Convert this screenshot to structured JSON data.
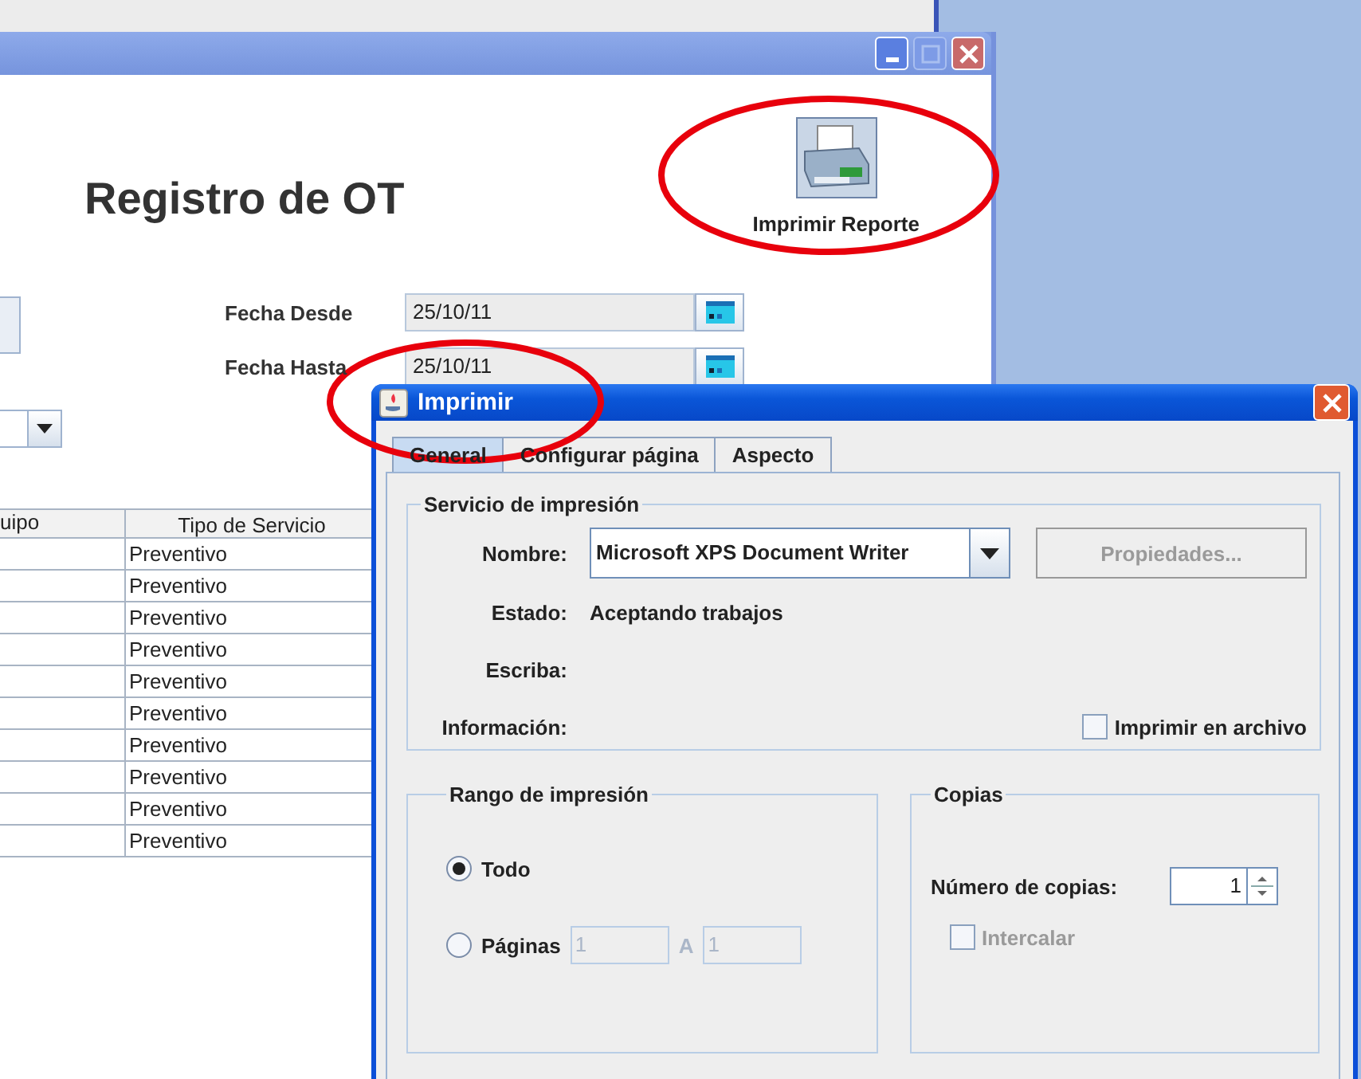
{
  "main_window": {
    "heading": "Registro de OT",
    "print_report_button": {
      "label": "Imprimir Reporte"
    },
    "date_fields": [
      {
        "label": "Fecha Desde",
        "value": "25/10/11"
      },
      {
        "label": "Fecha Hasta",
        "value": "25/10/11"
      }
    ],
    "table": {
      "columns": [
        "uipo",
        "Tipo de Servicio"
      ],
      "rows": [
        {
          "tipo_de_servicio": "Preventivo"
        },
        {
          "tipo_de_servicio": "Preventivo"
        },
        {
          "tipo_de_servicio": "Preventivo"
        },
        {
          "tipo_de_servicio": "Preventivo"
        },
        {
          "tipo_de_servicio": "Preventivo"
        },
        {
          "tipo_de_servicio": "Preventivo"
        },
        {
          "tipo_de_servicio": "Preventivo"
        },
        {
          "tipo_de_servicio": "Preventivo"
        },
        {
          "tipo_de_servicio": "Preventivo"
        },
        {
          "tipo_de_servicio": "Preventivo"
        }
      ]
    }
  },
  "annotations": [
    {
      "kind": "ellipse"
    },
    {
      "kind": "ellipse"
    }
  ],
  "dialog": {
    "title": "Imprimir",
    "tabs": [
      {
        "label": "General",
        "selected": true
      },
      {
        "label": "Configurar página",
        "selected": false
      },
      {
        "label": "Aspecto",
        "selected": false
      }
    ],
    "print_service": {
      "title": "Servicio de impresión",
      "name_label": "Nombre:",
      "printer": "Microsoft XPS Document Writer",
      "properties_button": {
        "label": "Propiedades...",
        "disabled": true
      },
      "status_label": "Estado:",
      "status": "Aceptando trabajos",
      "type_label": "Escriba:",
      "info_label": "Información:",
      "print_to_file": {
        "label": "Imprimir en archivo",
        "checked": false
      }
    },
    "print_range": {
      "title": "Rango de impresión",
      "options": [
        {
          "label": "Todo",
          "selected": true
        },
        {
          "label": "Páginas",
          "selected": false
        }
      ],
      "from": "1",
      "to_label": "A",
      "to": "1",
      "fields_disabled": true
    },
    "copies": {
      "title": "Copias",
      "label": "Número de copias:",
      "value": "1",
      "collate": {
        "label": "Intercalar",
        "checked": false,
        "disabled": true
      }
    }
  }
}
